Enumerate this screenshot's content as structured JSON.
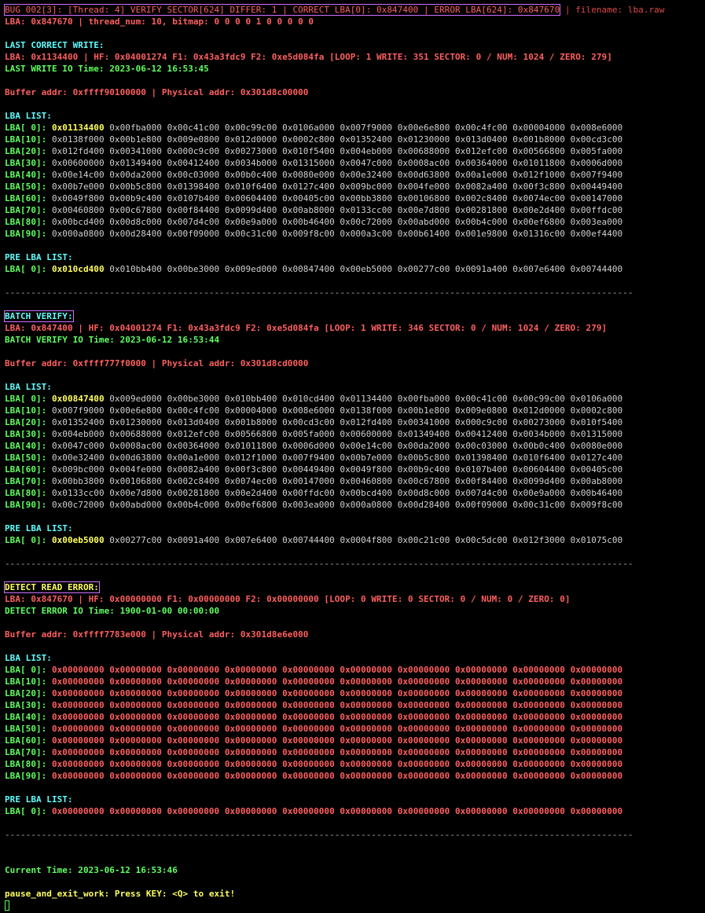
{
  "header": {
    "bug_line": "BUG 002[3]: [Thread: 4] VERIFY SECTOR[624] DIFFER: 1 | CORRECT LBA[0]: 0x847400 | ERROR LBA[624]: 0x847670",
    "filename": " | filename: lba.raw",
    "lba_line": "LBA: 0x847670 | thread_num: 10, bitmap: 0 0 0 0 1 0 0 0 0 0"
  },
  "sections": [
    {
      "title": "LAST CORRECT WRITE:",
      "info": "LBA: 0x1134400 | HF: 0x04001274 F1: 0x43a3fdc9 F2: 0xe5d084fa [LOOP: 1 WRITE: 351 SECTOR: 0 / NUM: 1024 / ZERO: 279]",
      "io_time": "LAST WRITE IO Time: 2023-06-12 16:53:45",
      "buffer": "Buffer addr: 0xffff90100000 | Physical addr: 0x301d8c00000",
      "lba_list_title": "LBA LIST:",
      "lba_rows": [
        {
          "label": "LBA[ 0]:",
          "first": "0x01134400",
          "rest": " 0x00fba000 0x00c41c00 0x00c99c00 0x0106a000 0x007f9000 0x00e6e800 0x00c4fc00 0x00004000 0x008e6000"
        },
        {
          "label": "LBA[10]:",
          "first": "",
          "rest": " 0x0138f000 0x00b1e800 0x009e0800 0x012d0000 0x0002c800 0x01352400 0x01230000 0x013d0400 0x001b8000 0x00cd3c00"
        },
        {
          "label": "LBA[20]:",
          "first": "",
          "rest": " 0x012fd400 0x00341000 0x000c9c00 0x00273000 0x010f5400 0x004eb000 0x00688000 0x012efc00 0x00566800 0x005fa000"
        },
        {
          "label": "LBA[30]:",
          "first": "",
          "rest": " 0x00600000 0x01349400 0x00412400 0x0034b000 0x01315000 0x0047c000 0x0008ac00 0x00364000 0x01011800 0x0006d000"
        },
        {
          "label": "LBA[40]:",
          "first": "",
          "rest": " 0x00e14c00 0x00da2000 0x00c03000 0x00b0c400 0x0080e000 0x00e32400 0x00d63800 0x00a1e000 0x012f1000 0x007f9400"
        },
        {
          "label": "LBA[50]:",
          "first": "",
          "rest": " 0x00b7e000 0x00b5c800 0x01398400 0x010f6400 0x0127c400 0x009bc000 0x004fe000 0x0082a400 0x00f3c800 0x00449400"
        },
        {
          "label": "LBA[60]:",
          "first": "",
          "rest": " 0x0049f800 0x00b9c400 0x0107b400 0x00604400 0x00405c00 0x00bb3800 0x00106800 0x002c8400 0x0074ec00 0x00147000"
        },
        {
          "label": "LBA[70]:",
          "first": "",
          "rest": " 0x00460800 0x00c67800 0x00f84400 0x0099d400 0x00ab8000 0x0133cc00 0x00e7d800 0x00281800 0x00e2d400 0x00ffdc00"
        },
        {
          "label": "LBA[80]:",
          "first": "",
          "rest": " 0x00bcd400 0x00d8c000 0x007d4c00 0x00e9a000 0x00b46400 0x00c72000 0x00abd000 0x00b4c000 0x00ef6800 0x003ea000"
        },
        {
          "label": "LBA[90]:",
          "first": "",
          "rest": " 0x000a0800 0x00d28400 0x00f09000 0x00c31c00 0x009f8c00 0x000a3c00 0x00b61400 0x001e9800 0x01316c00 0x00ef4400"
        }
      ],
      "pre_title": "PRE LBA LIST:",
      "pre_row": {
        "label": "LBA[ 0]:",
        "first": "0x010cd400",
        "rest": " 0x010bb400 0x00be3000 0x009ed000 0x00847400 0x00eb5000 0x00277c00 0x0091a400 0x007e6400 0x00744400"
      }
    },
    {
      "title": "BATCH VERIFY:",
      "info": "LBA: 0x847400 | HF: 0x04001274 F1: 0x43a3fdc9 F2: 0xe5d084fa [LOOP: 1 WRITE: 346 SECTOR: 0 / NUM: 1024 / ZERO: 279]",
      "io_time": "BATCH VERIFY IO Time: 2023-06-12 16:53:44",
      "buffer": "Buffer addr: 0xffff777f0000 | Physical addr: 0x301d8cd0000",
      "lba_list_title": "LBA LIST:",
      "lba_rows": [
        {
          "label": "LBA[ 0]:",
          "first": "0x00847400",
          "rest": " 0x009ed000 0x00be3000 0x010bb400 0x010cd400 0x01134400 0x00fba000 0x00c41c00 0x00c99c00 0x0106a000"
        },
        {
          "label": "LBA[10]:",
          "first": "",
          "rest": " 0x007f9000 0x00e6e800 0x00c4fc00 0x00004000 0x008e6000 0x0138f000 0x00b1e800 0x009e0800 0x012d0000 0x0002c800"
        },
        {
          "label": "LBA[20]:",
          "first": "",
          "rest": " 0x01352400 0x01230000 0x013d0400 0x001b8000 0x00cd3c00 0x012fd400 0x00341000 0x000c9c00 0x00273000 0x010f5400"
        },
        {
          "label": "LBA[30]:",
          "first": "",
          "rest": " 0x004eb000 0x00688000 0x012efc00 0x00566800 0x005fa000 0x00600000 0x01349400 0x00412400 0x0034b000 0x01315000"
        },
        {
          "label": "LBA[40]:",
          "first": "",
          "rest": " 0x0047c000 0x0008ac00 0x00364000 0x01011800 0x0006d000 0x00e14c00 0x00da2000 0x00c03000 0x00b0c400 0x0080e000"
        },
        {
          "label": "LBA[50]:",
          "first": "",
          "rest": " 0x00e32400 0x00d63800 0x00a1e000 0x012f1000 0x007f9400 0x00b7e000 0x00b5c800 0x01398400 0x010f6400 0x0127c400"
        },
        {
          "label": "LBA[60]:",
          "first": "",
          "rest": " 0x009bc000 0x004fe000 0x0082a400 0x00f3c800 0x00449400 0x0049f800 0x00b9c400 0x0107b400 0x00604400 0x00405c00"
        },
        {
          "label": "LBA[70]:",
          "first": "",
          "rest": " 0x00bb3800 0x00106800 0x002c8400 0x0074ec00 0x00147000 0x00460800 0x00c67800 0x00f84400 0x0099d400 0x00ab8000"
        },
        {
          "label": "LBA[80]:",
          "first": "",
          "rest": " 0x0133cc00 0x00e7d800 0x00281800 0x00e2d400 0x00ffdc00 0x00bcd400 0x00d8c000 0x007d4c00 0x00e9a000 0x00b46400"
        },
        {
          "label": "LBA[90]:",
          "first": "",
          "rest": " 0x00c72000 0x00abd000 0x00b4c000 0x00ef6800 0x003ea000 0x000a0800 0x00d28400 0x00f09000 0x00c31c00 0x009f8c00"
        }
      ],
      "pre_title": "PRE LBA LIST:",
      "pre_row": {
        "label": "LBA[ 0]:",
        "first": "0x00eb5000",
        "rest": " 0x00277c00 0x0091a400 0x007e6400 0x00744400 0x0004f800 0x00c21c00 0x00c5dc00 0x012f3000 0x01075c00"
      }
    },
    {
      "title": "DETECT READ ERROR:",
      "info": "LBA: 0x847670 | HF: 0x00000000 F1: 0x00000000 F2: 0x00000000 [LOOP: 0 WRITE: 0 SECTOR: 0 / NUM: 0 / ZERO: 0]",
      "io_time": "DETECT ERROR IO Time: 1900-01-00 00:00:00",
      "buffer": "Buffer addr: 0xffff7783e000 | Physical addr: 0x301d8e6e000",
      "lba_list_title": "LBA LIST:",
      "lba_rows": [
        {
          "label": "LBA[ 0]:",
          "first": "",
          "rest": " 0x00000000 0x00000000 0x00000000 0x00000000 0x00000000 0x00000000 0x00000000 0x00000000 0x00000000 0x00000000"
        },
        {
          "label": "LBA[10]:",
          "first": "",
          "rest": " 0x00000000 0x00000000 0x00000000 0x00000000 0x00000000 0x00000000 0x00000000 0x00000000 0x00000000 0x00000000"
        },
        {
          "label": "LBA[20]:",
          "first": "",
          "rest": " 0x00000000 0x00000000 0x00000000 0x00000000 0x00000000 0x00000000 0x00000000 0x00000000 0x00000000 0x00000000"
        },
        {
          "label": "LBA[30]:",
          "first": "",
          "rest": " 0x00000000 0x00000000 0x00000000 0x00000000 0x00000000 0x00000000 0x00000000 0x00000000 0x00000000 0x00000000"
        },
        {
          "label": "LBA[40]:",
          "first": "",
          "rest": " 0x00000000 0x00000000 0x00000000 0x00000000 0x00000000 0x00000000 0x00000000 0x00000000 0x00000000 0x00000000"
        },
        {
          "label": "LBA[50]:",
          "first": "",
          "rest": " 0x00000000 0x00000000 0x00000000 0x00000000 0x00000000 0x00000000 0x00000000 0x00000000 0x00000000 0x00000000"
        },
        {
          "label": "LBA[60]:",
          "first": "",
          "rest": " 0x00000000 0x00000000 0x00000000 0x00000000 0x00000000 0x00000000 0x00000000 0x00000000 0x00000000 0x00000000"
        },
        {
          "label": "LBA[70]:",
          "first": "",
          "rest": " 0x00000000 0x00000000 0x00000000 0x00000000 0x00000000 0x00000000 0x00000000 0x00000000 0x00000000 0x00000000"
        },
        {
          "label": "LBA[80]:",
          "first": "",
          "rest": " 0x00000000 0x00000000 0x00000000 0x00000000 0x00000000 0x00000000 0x00000000 0x00000000 0x00000000 0x00000000"
        },
        {
          "label": "LBA[90]:",
          "first": "",
          "rest": " 0x00000000 0x00000000 0x00000000 0x00000000 0x00000000 0x00000000 0x00000000 0x00000000 0x00000000 0x00000000"
        }
      ],
      "pre_title": "PRE LBA LIST:",
      "pre_row": {
        "label": "LBA[ 0]:",
        "first": "",
        "rest": " 0x00000000 0x00000000 0x00000000 0x00000000 0x00000000 0x00000000 0x00000000 0x00000000 0x00000000 0x00000000"
      }
    }
  ],
  "separator": "------------------------------------------------------------------------------------------------------------------------",
  "footer": {
    "current_time": "Current Time: 2023-06-12 16:53:46",
    "prompt": "pause_and_exit_work: Press KEY: <Q> to exit!"
  },
  "colors": {
    "background": "#000000",
    "error_red": "#ff5f5f",
    "ok_green": "#5fff5f",
    "title_cyan": "#5fffff",
    "highlight_yellow": "#ffff5f",
    "box_outline": "#d070ff"
  }
}
